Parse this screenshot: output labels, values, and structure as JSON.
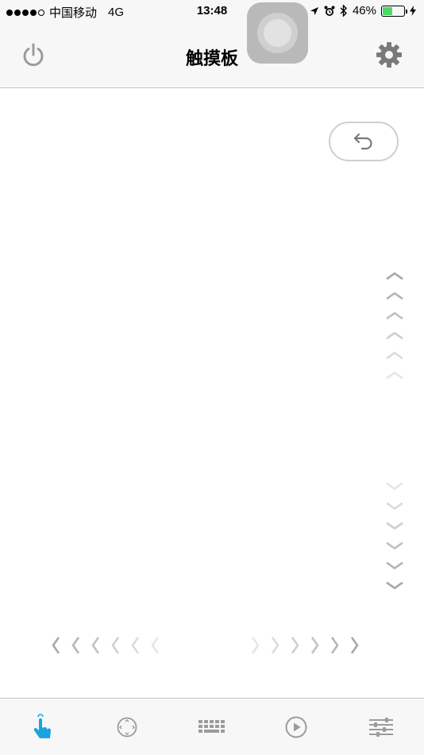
{
  "status_bar": {
    "carrier": "中国移动",
    "network": "4G",
    "time": "13:48",
    "battery_percent": "46%",
    "battery_level": 0.46
  },
  "nav": {
    "title": "触摸板",
    "left_icon": "power-icon",
    "right_icon": "gear-icon"
  },
  "touchpad": {
    "undo_icon": "undo-arrow-icon"
  },
  "tabs": [
    {
      "icon": "touch-hand-icon",
      "active": true
    },
    {
      "icon": "dpad-icon",
      "active": false
    },
    {
      "icon": "keyboard-icon",
      "active": false
    },
    {
      "icon": "play-icon",
      "active": false
    },
    {
      "icon": "sliders-icon",
      "active": false
    }
  ],
  "colors": {
    "accent": "#1aa3e0",
    "icon_gray": "#9b9b9b",
    "bar_bg": "#f7f7f7",
    "divider": "#c8c8c8",
    "battery_green": "#4cd964"
  }
}
